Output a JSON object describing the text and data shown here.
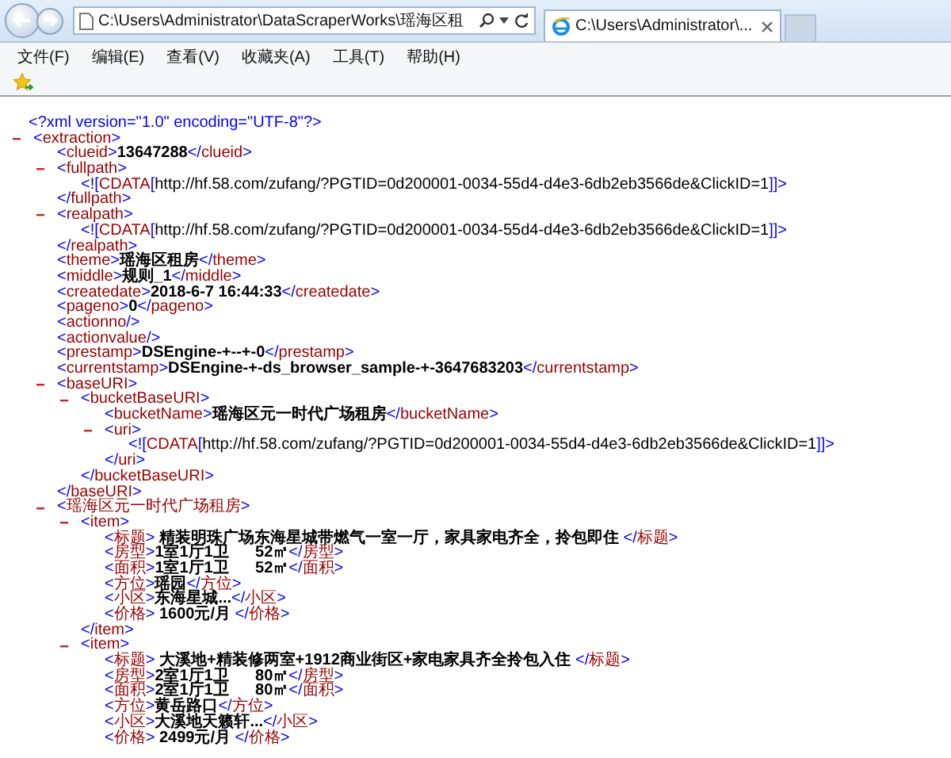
{
  "browser": {
    "address": "C:\\Users\\Administrator\\DataScraperWorks\\瑶海区租",
    "tab": {
      "title": "C:\\Users\\Administrator\\...",
      "selected": true
    },
    "menu": [
      "文件(F)",
      "编辑(E)",
      "查看(V)",
      "收藏夹(A)",
      "工具(T)",
      "帮助(H)"
    ]
  },
  "document": [
    {
      "kind": "pi",
      "text": "<?xml version=\"1.0\" encoding=\"UTF-8\"?>"
    },
    {
      "kind": "element",
      "open": "<extraction>",
      "expanded": true,
      "children": [
        {
          "kind": "leaf",
          "open": "<clueid>",
          "value": "13647288",
          "close": "</clueid>"
        },
        {
          "kind": "element",
          "open": "<fullpath>",
          "close": "</fullpath>",
          "expanded": true,
          "children": [
            {
              "kind": "cdata",
              "open": "<![CDATA[",
              "value": "http://hf.58.com/zufang/?PGTID=0d200001-0034-55d4-d4e3-6db2eb3566de&ClickID=1",
              "close": "]]>"
            }
          ]
        },
        {
          "kind": "element",
          "open": "<realpath>",
          "close": "</realpath>",
          "expanded": true,
          "children": [
            {
              "kind": "cdata",
              "open": "<![CDATA[",
              "value": "http://hf.58.com/zufang/?PGTID=0d200001-0034-55d4-d4e3-6db2eb3566de&ClickID=1",
              "close": "]]>"
            }
          ]
        },
        {
          "kind": "leaf",
          "open": "<theme>",
          "value": "瑶海区租房",
          "close": "</theme>"
        },
        {
          "kind": "leaf",
          "open": "<middle>",
          "value": "规则_1",
          "close": "</middle>"
        },
        {
          "kind": "leaf",
          "open": "<createdate>",
          "value": "2018-6-7 16:44:33",
          "close": "</createdate>"
        },
        {
          "kind": "leaf",
          "open": "<pageno>",
          "value": "0",
          "close": "</pageno>"
        },
        {
          "kind": "empty",
          "open": "<actionno/>"
        },
        {
          "kind": "empty",
          "open": "<actionvalue/>"
        },
        {
          "kind": "leaf",
          "open": "<prestamp>",
          "value": "DSEngine-+--+-0",
          "close": "</prestamp>"
        },
        {
          "kind": "leaf",
          "open": "<currentstamp>",
          "value": "DSEngine-+-ds_browser_sample-+-3647683203",
          "close": "</currentstamp>"
        },
        {
          "kind": "element",
          "open": "<baseURI>",
          "close": "</baseURI>",
          "expanded": true,
          "children": [
            {
              "kind": "element",
              "open": "<bucketBaseURI>",
              "close": "</bucketBaseURI>",
              "expanded": true,
              "children": [
                {
                  "kind": "leaf",
                  "open": "<bucketName>",
                  "value": "瑶海区元一时代广场租房",
                  "close": "</bucketName>"
                },
                {
                  "kind": "element",
                  "open": "<uri>",
                  "close": "</uri>",
                  "expanded": true,
                  "children": [
                    {
                      "kind": "cdata",
                      "open": "<![CDATA[",
                      "value": "http://hf.58.com/zufang/?PGTID=0d200001-0034-55d4-d4e3-6db2eb3566de&ClickID=1",
                      "close": "]]>"
                    }
                  ]
                }
              ]
            }
          ]
        },
        {
          "kind": "element",
          "open": "<瑶海区元一时代广场租房>",
          "expanded": true,
          "children": [
            {
              "kind": "element",
              "open": "<item>",
              "close": "</item>",
              "expanded": true,
              "children": [
                {
                  "kind": "leaf",
                  "open": "<标题>",
                  "value": " 精装明珠广场东海星城带燃气一室一厅，家具家电齐全，拎包即住 ",
                  "close": "</标题>"
                },
                {
                  "kind": "leaf",
                  "open": "<房型>",
                  "value": "1室1厅1卫      52㎡",
                  "close": "</房型>"
                },
                {
                  "kind": "leaf",
                  "open": "<面积>",
                  "value": "1室1厅1卫      52㎡",
                  "close": "</面积>"
                },
                {
                  "kind": "leaf",
                  "open": "<方位>",
                  "value": "瑶园",
                  "close": "</方位>"
                },
                {
                  "kind": "leaf",
                  "open": "<小区>",
                  "value": "东海星城...",
                  "close": "</小区>"
                },
                {
                  "kind": "leaf",
                  "open": "<价格>",
                  "value": " 1600元/月 ",
                  "close": "</价格>"
                }
              ]
            },
            {
              "kind": "element",
              "open": "<item>",
              "expanded": true,
              "children": [
                {
                  "kind": "leaf",
                  "open": "<标题>",
                  "value": " 大溪地+精装修两室+1912商业街区+家电家具齐全拎包入住 ",
                  "close": "</标题>"
                },
                {
                  "kind": "leaf",
                  "open": "<房型>",
                  "value": "2室1厅1卫      80㎡",
                  "close": "</房型>"
                },
                {
                  "kind": "leaf",
                  "open": "<面积>",
                  "value": "2室1厅1卫      80㎡",
                  "close": "</面积>"
                },
                {
                  "kind": "leaf",
                  "open": "<方位>",
                  "value": "黄岳路口",
                  "close": "</方位>"
                },
                {
                  "kind": "leaf",
                  "open": "<小区>",
                  "value": "大溪地天籁轩...",
                  "close": "</小区>"
                },
                {
                  "kind": "leaf",
                  "open": "<价格>",
                  "value": " 2499元/月 ",
                  "close": "</价格>"
                }
              ]
            }
          ]
        }
      ]
    }
  ]
}
